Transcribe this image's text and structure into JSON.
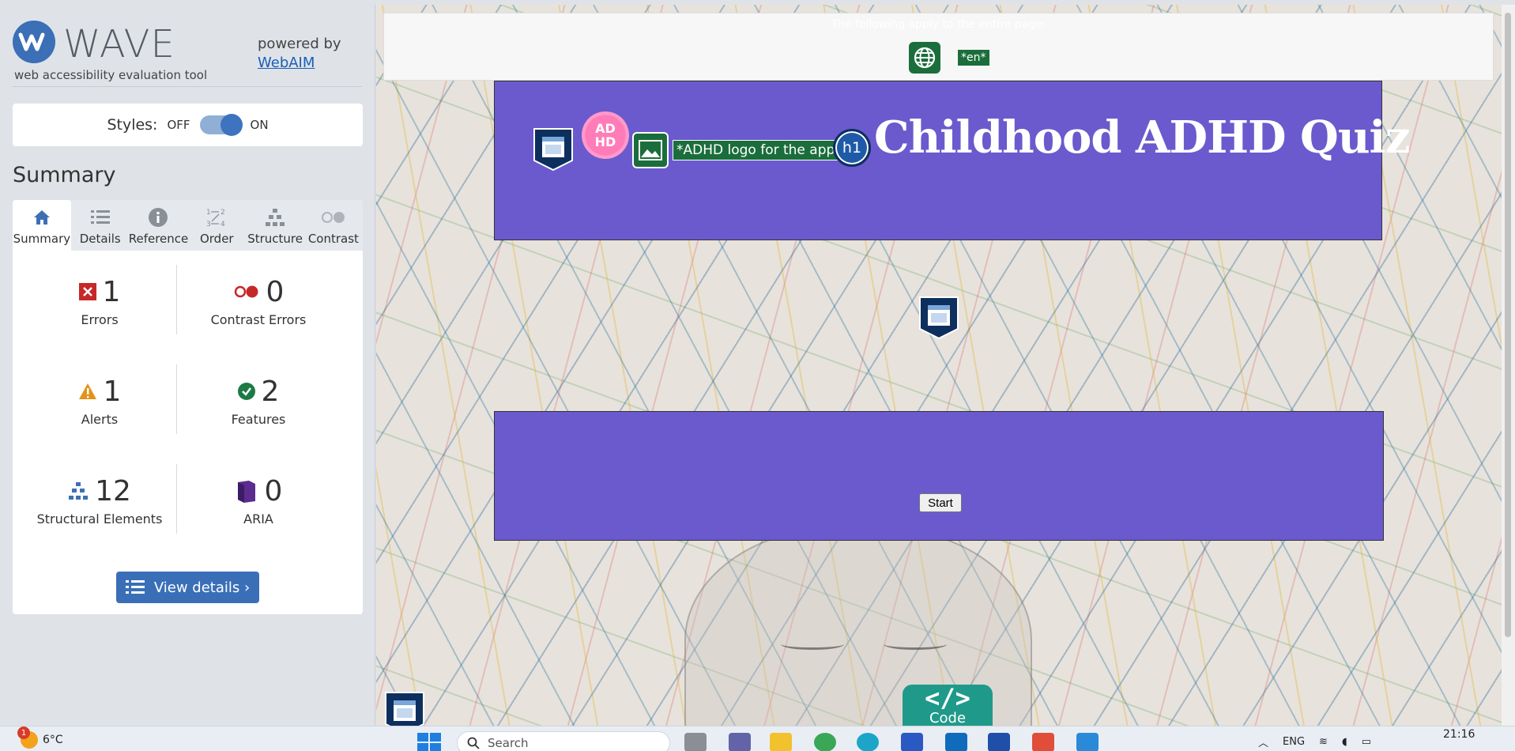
{
  "wave": {
    "brand": "WAVE",
    "tagline": "web accessibility evaluation tool",
    "powered_by": "powered by",
    "powered_link": "WebAIM",
    "styles_label": "Styles:",
    "styles_off": "OFF",
    "styles_on": "ON",
    "summary_title": "Summary",
    "tabs": [
      {
        "label": "Summary",
        "icon": "home-icon"
      },
      {
        "label": "Details",
        "icon": "list-icon"
      },
      {
        "label": "Reference",
        "icon": "info-icon"
      },
      {
        "label": "Order",
        "icon": "order-icon"
      },
      {
        "label": "Structure",
        "icon": "structure-icon"
      },
      {
        "label": "Contrast",
        "icon": "contrast-icon"
      }
    ],
    "stats": {
      "errors": {
        "count": "1",
        "label": "Errors"
      },
      "contrast_errors": {
        "count": "0",
        "label": "Contrast Errors"
      },
      "alerts": {
        "count": "1",
        "label": "Alerts"
      },
      "features": {
        "count": "2",
        "label": "Features"
      },
      "structural": {
        "count": "12",
        "label": "Structural Elements"
      },
      "aria": {
        "count": "0",
        "label": "ARIA"
      }
    },
    "view_details": "View details ›"
  },
  "page": {
    "lang_note": "The following apply to the entire page:",
    "lang_chip": "*en*",
    "logo_letters_1": "AD",
    "logo_letters_2": "HD",
    "alt_text": "*ADHD logo for the app*",
    "h1_badge": "h1",
    "title": "Childhood ADHD Quiz",
    "start_label": "Start",
    "code_symbol": "</>",
    "code_label": "Code"
  },
  "taskbar": {
    "temperature": "6°C",
    "weather_badge": "1",
    "search_placeholder": "Search",
    "language": "ENG",
    "time": "21:16"
  },
  "colors": {
    "wave_blue": "#3a6fb8",
    "quiz_purple": "#6a5acd",
    "wave_green": "#1b6e3c",
    "code_teal": "#1f9a8a"
  }
}
